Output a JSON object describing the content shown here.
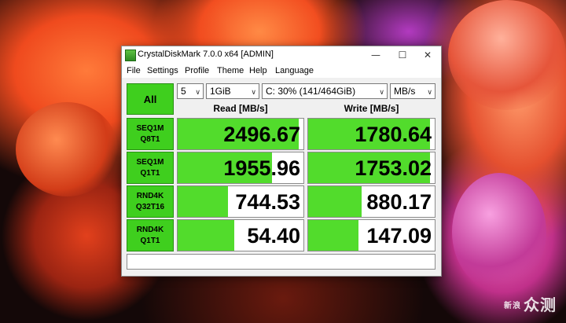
{
  "window": {
    "title": "CrystalDiskMark 7.0.0 x64 [ADMIN]",
    "controls": {
      "minimize": "—",
      "maximize": "☐",
      "close": "✕"
    }
  },
  "menu": [
    "File",
    "Settings",
    "Profile",
    "Theme",
    "Help",
    "Language"
  ],
  "toolbar": {
    "all_label": "All",
    "count": "5",
    "size": "1GiB",
    "drive": "C: 30% (141/464GiB)",
    "unit": "MB/s"
  },
  "columns": {
    "read": "Read [MB/s]",
    "write": "Write [MB/s]"
  },
  "rows": [
    {
      "line1": "SEQ1M",
      "line2": "Q8T1",
      "read": "2496.67",
      "write": "1780.64",
      "read_fill": 0.96,
      "write_fill": 0.96
    },
    {
      "line1": "SEQ1M",
      "line2": "Q1T1",
      "read": "1955.96",
      "write": "1753.02",
      "read_fill": 0.75,
      "write_fill": 0.96
    },
    {
      "line1": "RND4K",
      "line2": "Q32T16",
      "read": "744.53",
      "write": "880.17",
      "read_fill": 0.4,
      "write_fill": 0.42
    },
    {
      "line1": "RND4K",
      "line2": "Q1T1",
      "read": "54.40",
      "write": "147.09",
      "read_fill": 0.45,
      "write_fill": 0.4
    }
  ],
  "comment": "",
  "watermark": {
    "small": "新浪",
    "big": "众测"
  },
  "colors": {
    "accent_green": "#3fcf1e",
    "bar_green": "#52dc2c"
  }
}
